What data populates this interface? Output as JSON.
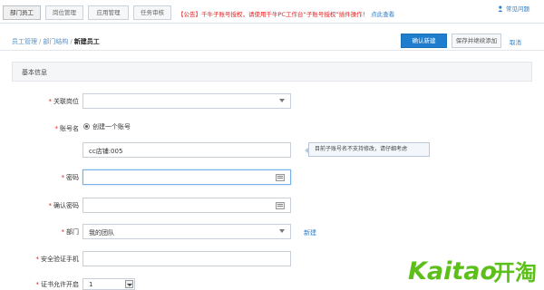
{
  "tabs": [
    {
      "label": "部门员工"
    },
    {
      "label": "岗位管理"
    },
    {
      "label": "应用管理"
    },
    {
      "label": "任务审核"
    }
  ],
  "notice": {
    "text": "【公告】千牛子账号授权，请使用千牛PC工作台“子账号授权”插件操作！",
    "link": "点此查看"
  },
  "help": {
    "label": "常见问题"
  },
  "breadcrumb": {
    "items": [
      "员工管理",
      "部门结构"
    ],
    "current": "新建员工"
  },
  "actions": {
    "confirm": "确认新建",
    "save_continue": "保存并继续添加",
    "cancel": "取消"
  },
  "section": {
    "title": "基本信息"
  },
  "form": {
    "position": {
      "label": "关联岗位",
      "value": ""
    },
    "account": {
      "label": "账号名",
      "radio": "创建一个账号",
      "value": "cc店铺:005",
      "tip": "目前子账号名不支持修改，请仔细考虑"
    },
    "password": {
      "label": "密码",
      "value": ""
    },
    "confirm_password": {
      "label": "确认密码",
      "value": ""
    },
    "department": {
      "label": "部门",
      "value": "我的团队",
      "new_link": "新建"
    },
    "security_phone": {
      "label": "安全验证手机",
      "value": ""
    },
    "login_allowed": {
      "label": "证书允许开启",
      "value": "1"
    }
  },
  "watermark": {
    "text": "Kaitao开淘"
  },
  "colors": {
    "brand_green": "#5cbf1a",
    "accent_blue": "#1f7dcd",
    "required_red": "#e02020"
  }
}
